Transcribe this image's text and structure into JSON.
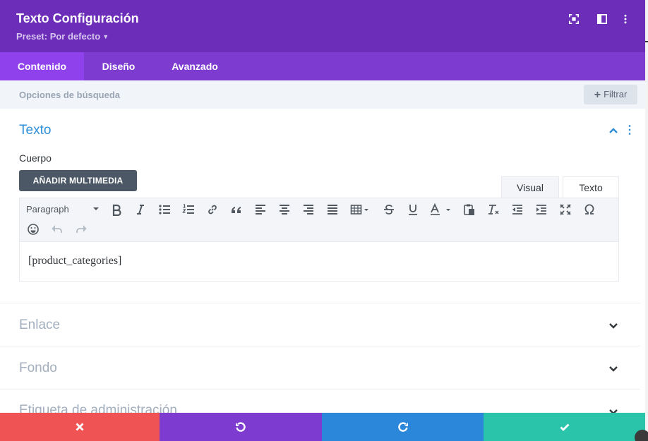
{
  "header": {
    "title": "Texto Configuración",
    "preset": "Preset: Por defecto"
  },
  "tabs": [
    {
      "label": "Contenido",
      "active": true
    },
    {
      "label": "Diseño",
      "active": false
    },
    {
      "label": "Avanzado",
      "active": false
    }
  ],
  "search": {
    "placeholder": "Opciones de búsqueda",
    "filter_label": "Filtrar"
  },
  "text_section": {
    "title": "Texto",
    "body_label": "Cuerpo",
    "add_media_label": "AÑADIR MULTIMEDIA",
    "mode_visual": "Visual",
    "mode_text": "Texto",
    "format_select": "Paragraph",
    "editor_content": "[product_categories]"
  },
  "sections": [
    {
      "title": "Enlace"
    },
    {
      "title": "Fondo"
    },
    {
      "title": "Etiqueta de administración"
    }
  ],
  "colors": {
    "header": "#6c2eb9",
    "tabs": "#7e3bd0",
    "active_tab": "#8f42ec",
    "accent_blue": "#2e8fd8",
    "close": "#ef5353",
    "undo": "#7e3bd0",
    "redo": "#2b87da",
    "save": "#29c4a9"
  }
}
